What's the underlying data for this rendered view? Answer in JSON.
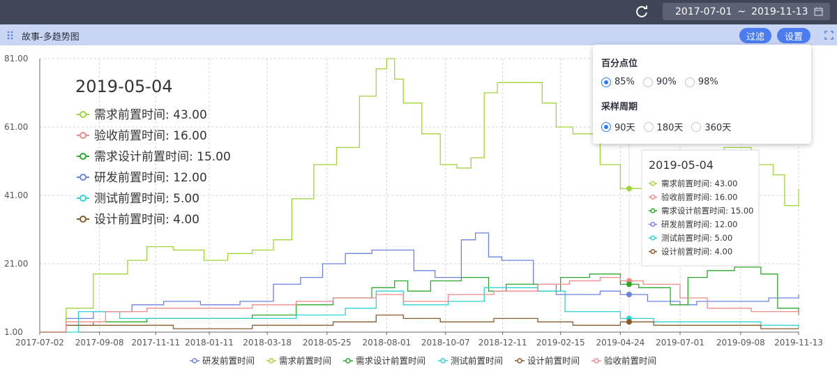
{
  "header": {
    "date_start": "2017-07-01",
    "date_sep": "~",
    "date_end": "2019-11-13"
  },
  "panel": {
    "title": "故事-多趋势图",
    "filter_label": "过滤",
    "settings_label": "设置"
  },
  "settings": {
    "percentile_heading": "百分点位",
    "percentile_options": [
      "85%",
      "90%",
      "98%"
    ],
    "percentile_selected": "85%",
    "period_heading": "采样周期",
    "period_options": [
      "90天",
      "180天",
      "360天"
    ],
    "period_selected": "90天"
  },
  "colors": {
    "研发前置时间": "#6b83e0",
    "需求前置时间": "#9ed63a",
    "需求设计前置时间": "#2ba82b",
    "测试前置时间": "#2cd3d3",
    "设计前置时间": "#8b5a2b",
    "验收前置时间": "#ef8a8a"
  },
  "chart_data": {
    "type": "line",
    "xlabel": "",
    "ylabel": "",
    "ylim": [
      1,
      81
    ],
    "yticks": [
      "1.00",
      "21.00",
      "41.00",
      "61.00",
      "81.00"
    ],
    "xticks": [
      "2017-07-02",
      "2017-09-08",
      "2017-11-11",
      "2018-01-11",
      "2018-03-18",
      "2018-05-25",
      "2018-08-01",
      "2018-10-07",
      "2018-12-11",
      "2019-02-15",
      "2019-04-24",
      "2019-07-01",
      "2019-09-08",
      "2019-11-13"
    ],
    "xrange": [
      "2017-07-02",
      "2019-11-13"
    ],
    "grid": true,
    "legend_position": "bottom",
    "series": [
      {
        "name": "研发前置时间",
        "points": [
          [
            "2017-07-02",
            1
          ],
          [
            "2017-08-01",
            5
          ],
          [
            "2017-09-01",
            7
          ],
          [
            "2017-10-15",
            9
          ],
          [
            "2017-11-20",
            10
          ],
          [
            "2018-01-01",
            9
          ],
          [
            "2018-02-15",
            10
          ],
          [
            "2018-03-25",
            15
          ],
          [
            "2018-04-25",
            17
          ],
          [
            "2018-05-20",
            21
          ],
          [
            "2018-06-15",
            24
          ],
          [
            "2018-07-15",
            25
          ],
          [
            "2018-08-10",
            25
          ],
          [
            "2018-09-01",
            19
          ],
          [
            "2018-09-25",
            17
          ],
          [
            "2018-10-15",
            17
          ],
          [
            "2018-10-25",
            28
          ],
          [
            "2018-11-10",
            30
          ],
          [
            "2018-11-25",
            23
          ],
          [
            "2018-12-10",
            22
          ],
          [
            "2019-01-05",
            22
          ],
          [
            "2019-01-15",
            15
          ],
          [
            "2019-02-10",
            12
          ],
          [
            "2019-03-05",
            12
          ],
          [
            "2019-04-01",
            13
          ],
          [
            "2019-04-24",
            12
          ],
          [
            "2019-05-25",
            10
          ],
          [
            "2019-07-01",
            9
          ],
          [
            "2019-07-20",
            10
          ],
          [
            "2019-09-10",
            10
          ],
          [
            "2019-10-10",
            11
          ],
          [
            "2019-11-13",
            12
          ]
        ]
      },
      {
        "name": "需求前置时间",
        "points": [
          [
            "2017-07-02",
            1
          ],
          [
            "2017-08-01",
            8
          ],
          [
            "2017-09-01",
            18
          ],
          [
            "2017-10-10",
            22
          ],
          [
            "2017-11-01",
            26
          ],
          [
            "2017-12-01",
            25
          ],
          [
            "2018-01-05",
            22
          ],
          [
            "2018-02-01",
            24
          ],
          [
            "2018-03-01",
            25
          ],
          [
            "2018-03-25",
            28
          ],
          [
            "2018-04-15",
            40
          ],
          [
            "2018-05-10",
            50
          ],
          [
            "2018-06-05",
            55
          ],
          [
            "2018-07-01",
            70
          ],
          [
            "2018-07-20",
            78
          ],
          [
            "2018-08-01",
            81
          ],
          [
            "2018-08-10",
            75
          ],
          [
            "2018-08-20",
            68
          ],
          [
            "2018-09-10",
            59
          ],
          [
            "2018-10-01",
            50
          ],
          [
            "2018-10-20",
            49
          ],
          [
            "2018-11-05",
            52
          ],
          [
            "2018-11-20",
            71
          ],
          [
            "2018-12-05",
            74
          ],
          [
            "2019-01-10",
            74
          ],
          [
            "2019-01-25",
            68
          ],
          [
            "2019-02-10",
            61
          ],
          [
            "2019-03-01",
            59
          ],
          [
            "2019-04-01",
            50
          ],
          [
            "2019-04-24",
            43
          ],
          [
            "2019-05-25",
            45
          ],
          [
            "2019-06-25",
            50
          ],
          [
            "2019-07-20",
            53
          ],
          [
            "2019-08-20",
            55
          ],
          [
            "2019-09-20",
            50
          ],
          [
            "2019-10-15",
            47
          ],
          [
            "2019-10-28",
            38
          ],
          [
            "2019-11-13",
            43
          ]
        ]
      },
      {
        "name": "需求设计前置时间",
        "points": [
          [
            "2017-07-02",
            1
          ],
          [
            "2017-08-01",
            3
          ],
          [
            "2017-09-01",
            4
          ],
          [
            "2017-11-01",
            5
          ],
          [
            "2018-01-05",
            5
          ],
          [
            "2018-03-01",
            6
          ],
          [
            "2018-04-20",
            9
          ],
          [
            "2018-06-01",
            11
          ],
          [
            "2018-07-15",
            14
          ],
          [
            "2018-08-10",
            16
          ],
          [
            "2018-08-25",
            13
          ],
          [
            "2018-09-20",
            16
          ],
          [
            "2018-10-25",
            17
          ],
          [
            "2018-11-25",
            13
          ],
          [
            "2018-12-15",
            15
          ],
          [
            "2019-01-20",
            13
          ],
          [
            "2019-02-15",
            17
          ],
          [
            "2019-03-20",
            18
          ],
          [
            "2019-04-24",
            15
          ],
          [
            "2019-05-15",
            14
          ],
          [
            "2019-06-20",
            9
          ],
          [
            "2019-07-10",
            17
          ],
          [
            "2019-08-01",
            19
          ],
          [
            "2019-09-01",
            20
          ],
          [
            "2019-10-01",
            18
          ],
          [
            "2019-10-20",
            8
          ],
          [
            "2019-11-13",
            6
          ]
        ]
      },
      {
        "name": "测试前置时间",
        "points": [
          [
            "2017-07-02",
            1
          ],
          [
            "2017-08-15",
            7
          ],
          [
            "2017-10-01",
            5
          ],
          [
            "2018-01-01",
            5
          ],
          [
            "2018-03-01",
            5
          ],
          [
            "2018-04-20",
            6
          ],
          [
            "2018-06-15",
            8
          ],
          [
            "2018-07-20",
            13
          ],
          [
            "2018-08-20",
            9
          ],
          [
            "2018-10-10",
            10
          ],
          [
            "2018-11-20",
            14
          ],
          [
            "2019-01-20",
            13
          ],
          [
            "2019-02-20",
            7
          ],
          [
            "2019-04-24",
            5
          ],
          [
            "2019-06-01",
            4
          ],
          [
            "2019-08-01",
            4
          ],
          [
            "2019-10-01",
            3
          ],
          [
            "2019-11-13",
            2
          ]
        ]
      },
      {
        "name": "设计前置时间",
        "points": [
          [
            "2017-07-02",
            1
          ],
          [
            "2017-08-01",
            3
          ],
          [
            "2017-10-01",
            3
          ],
          [
            "2017-12-01",
            2
          ],
          [
            "2018-02-01",
            2
          ],
          [
            "2018-03-01",
            3
          ],
          [
            "2018-04-15",
            3
          ],
          [
            "2018-06-01",
            4
          ],
          [
            "2018-07-20",
            6
          ],
          [
            "2018-08-20",
            5
          ],
          [
            "2018-10-01",
            4
          ],
          [
            "2018-12-01",
            5
          ],
          [
            "2019-01-20",
            4
          ],
          [
            "2019-03-01",
            3
          ],
          [
            "2019-04-24",
            4
          ],
          [
            "2019-06-01",
            3
          ],
          [
            "2019-08-01",
            3
          ],
          [
            "2019-10-01",
            2
          ],
          [
            "2019-11-13",
            2
          ]
        ]
      },
      {
        "name": "验收前置时间",
        "points": [
          [
            "2017-07-02",
            1
          ],
          [
            "2017-08-01",
            4
          ],
          [
            "2017-09-15",
            7
          ],
          [
            "2017-11-01",
            8
          ],
          [
            "2018-01-01",
            8
          ],
          [
            "2018-03-01",
            9
          ],
          [
            "2018-04-20",
            10
          ],
          [
            "2018-06-01",
            11
          ],
          [
            "2018-07-20",
            12
          ],
          [
            "2018-08-20",
            10
          ],
          [
            "2018-10-10",
            12
          ],
          [
            "2018-12-01",
            13
          ],
          [
            "2019-01-20",
            15
          ],
          [
            "2019-02-25",
            16
          ],
          [
            "2019-04-01",
            17
          ],
          [
            "2019-04-24",
            16
          ],
          [
            "2019-05-20",
            15
          ],
          [
            "2019-07-01",
            11
          ],
          [
            "2019-08-01",
            8
          ],
          [
            "2019-09-20",
            7
          ],
          [
            "2019-11-13",
            6
          ]
        ]
      }
    ],
    "annotations": [
      {
        "date": "2019-05-04",
        "items": [
          {
            "name": "需求前置时间",
            "value": "43.00"
          },
          {
            "name": "验收前置时间",
            "value": "16.00"
          },
          {
            "name": "需求设计前置时间",
            "value": "15.00"
          },
          {
            "name": "研发前置时间",
            "value": "12.00"
          },
          {
            "name": "测试前置时间",
            "value": "5.00"
          },
          {
            "name": "设计前置时间",
            "value": "4.00"
          }
        ]
      }
    ],
    "legend": [
      "研发前置时间",
      "需求前置时间",
      "需求设计前置时间",
      "测试前置时间",
      "设计前置时间",
      "验收前置时间"
    ]
  }
}
